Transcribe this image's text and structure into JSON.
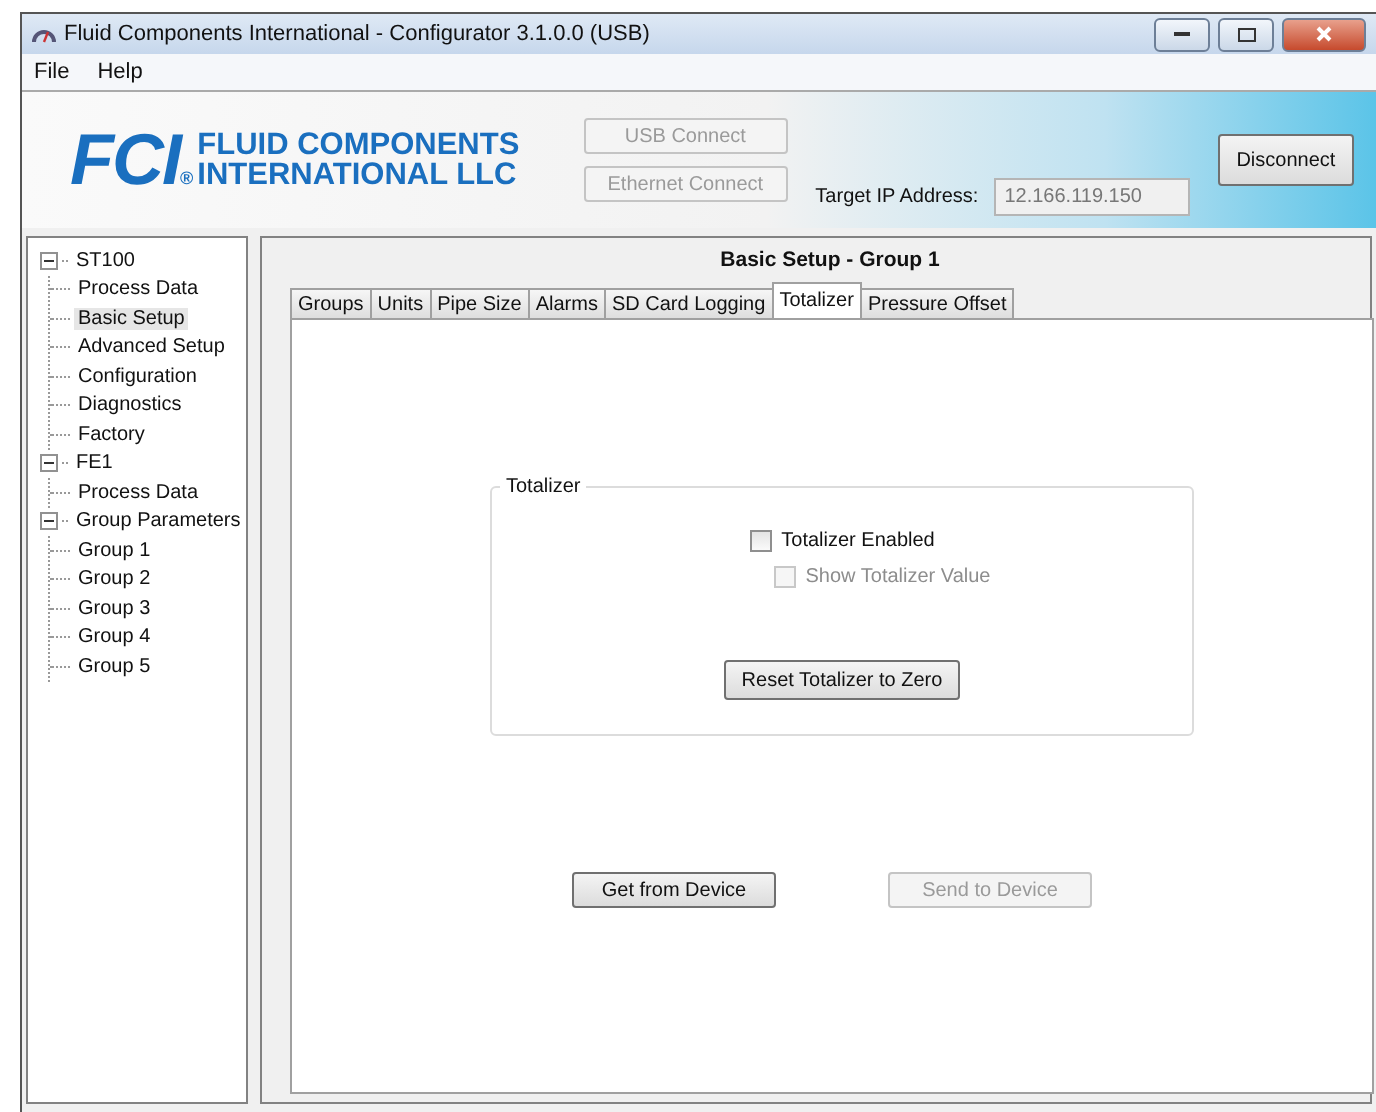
{
  "window": {
    "title": "Fluid Components International - Configurator 3.1.0.0 (USB)"
  },
  "menu": [
    "File",
    "Help"
  ],
  "header": {
    "logo_mark": "FCI",
    "logo_reg": "®",
    "logo_line_1": "FLUID COMPONENTS",
    "logo_line_2": "INTERNATIONAL LLC",
    "usb_button": {
      "label": "USB Connect",
      "disabled": true
    },
    "ethernet_button": {
      "label": "Ethernet Connect",
      "disabled": true
    },
    "ip_label": "Target IP Address:",
    "ip_value": "12.166.119.150",
    "ip_disabled": true,
    "disconnect_button": {
      "label": "Disconnect",
      "disabled": false
    }
  },
  "tree": [
    {
      "label": "ST100",
      "expanded": true,
      "selected": false,
      "children": [
        {
          "label": "Process Data",
          "selected": false
        },
        {
          "label": "Basic Setup",
          "selected": true
        },
        {
          "label": "Advanced Setup",
          "selected": false
        },
        {
          "label": "Configuration",
          "selected": false
        },
        {
          "label": "Diagnostics",
          "selected": false
        },
        {
          "label": "Factory",
          "selected": false
        }
      ]
    },
    {
      "label": "FE1",
      "expanded": true,
      "selected": false,
      "children": [
        {
          "label": "Process Data",
          "selected": false
        }
      ]
    },
    {
      "label": "Group Parameters",
      "expanded": true,
      "selected": false,
      "children": [
        {
          "label": "Group 1",
          "selected": false
        },
        {
          "label": "Group 2",
          "selected": false
        },
        {
          "label": "Group 3",
          "selected": false
        },
        {
          "label": "Group 4",
          "selected": false
        },
        {
          "label": "Group 5",
          "selected": false
        }
      ]
    }
  ],
  "content": {
    "title": "Basic Setup - Group 1",
    "tabs": [
      {
        "label": "Groups",
        "selected": false
      },
      {
        "label": "Units",
        "selected": false
      },
      {
        "label": "Pipe Size",
        "selected": false
      },
      {
        "label": "Alarms",
        "selected": false
      },
      {
        "label": "SD Card Logging",
        "selected": false
      },
      {
        "label": "Totalizer",
        "selected": true
      },
      {
        "label": "Pressure Offset",
        "selected": false
      }
    ],
    "group": {
      "title": "Totalizer",
      "checkboxes": [
        {
          "label": "Totalizer Enabled",
          "checked": false,
          "disabled": false
        },
        {
          "label": "Show Totalizer Value",
          "checked": false,
          "disabled": true
        }
      ],
      "reset_button": {
        "label": "Reset Totalizer to Zero",
        "disabled": false
      }
    },
    "get_button": {
      "label": "Get from Device",
      "disabled": false
    },
    "send_button": {
      "label": "Send to Device",
      "disabled": true
    }
  }
}
